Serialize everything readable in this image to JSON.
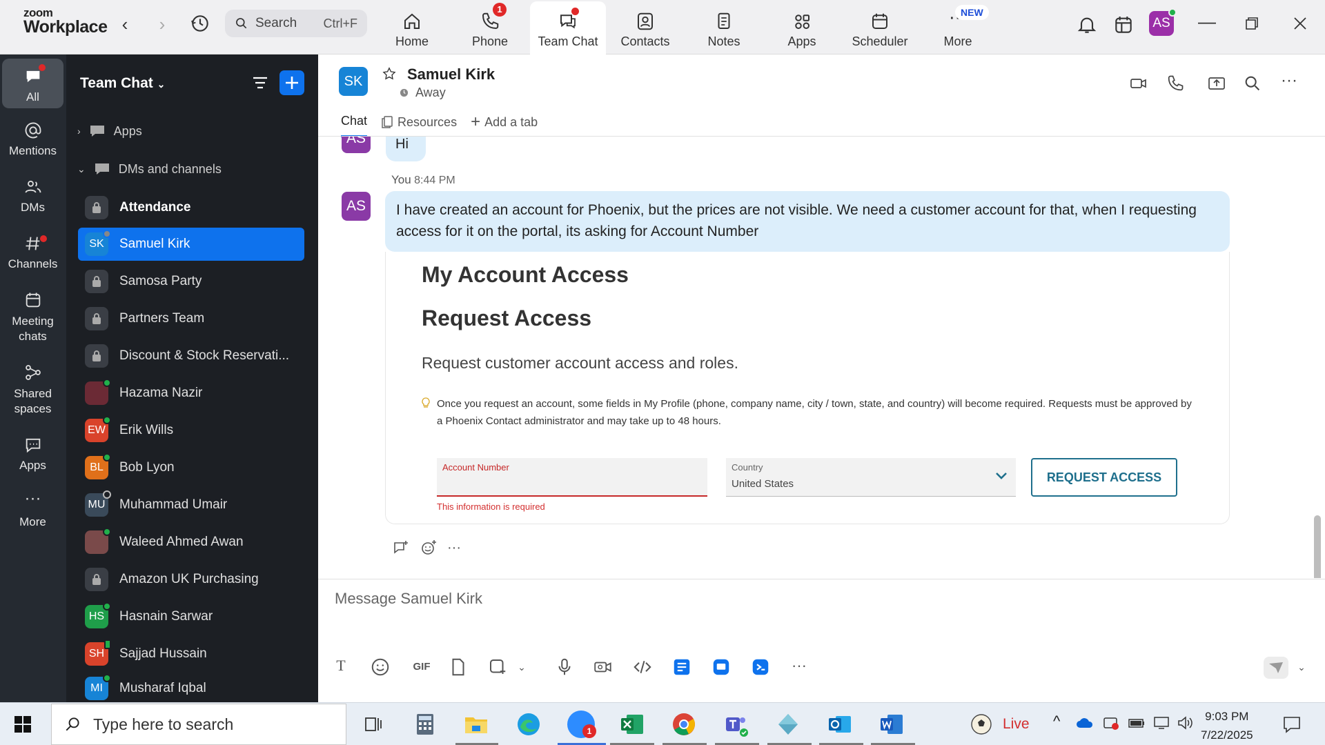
{
  "topbar": {
    "logo_line1": "zoom",
    "logo_line2": "Workplace",
    "search_placeholder": "Search",
    "search_shortcut": "Ctrl+F",
    "tabs": [
      {
        "label": "Home",
        "icon": "home-icon"
      },
      {
        "label": "Phone",
        "icon": "phone-icon",
        "badge": "1"
      },
      {
        "label": "Team Chat",
        "icon": "chat-icon",
        "active": true
      },
      {
        "label": "Contacts",
        "icon": "contacts-icon"
      },
      {
        "label": "Notes",
        "icon": "notes-icon"
      },
      {
        "label": "Apps",
        "icon": "apps-icon"
      },
      {
        "label": "Scheduler",
        "icon": "calendar-icon"
      },
      {
        "label": "More",
        "icon": "more-icon",
        "tag": "NEW"
      }
    ],
    "user_initials": "AS"
  },
  "rail": {
    "items": [
      {
        "label": "All",
        "icon": "chat-bubble-icon",
        "active": true
      },
      {
        "label": "Mentions",
        "icon": "at-icon"
      },
      {
        "label": "DMs",
        "icon": "people-icon"
      },
      {
        "label": "Channels",
        "icon": "hash-icon"
      },
      {
        "label": "Meeting chats",
        "icon": "calendar-icon"
      },
      {
        "label": "Shared spaces",
        "icon": "shared-icon"
      },
      {
        "label": "Apps",
        "icon": "apps-icon"
      },
      {
        "label": "More",
        "icon": "ellipsis-icon"
      }
    ]
  },
  "panel": {
    "title": "Team Chat",
    "section_apps": "Apps",
    "section_dms": "DMs and channels",
    "items": [
      {
        "label": "Attendance",
        "type": "lock",
        "bold": true
      },
      {
        "label": "Samuel Kirk",
        "initials": "SK",
        "color": "#1784d6",
        "selected": true
      },
      {
        "label": "Samosa Party",
        "type": "lock"
      },
      {
        "label": "Partners Team",
        "type": "lock"
      },
      {
        "label": "Discount & Stock Reservati...",
        "type": "lock"
      },
      {
        "label": "Hazama Nazir",
        "initials": "",
        "color": "#6b2a35",
        "status": "online"
      },
      {
        "label": "Erik Wills",
        "initials": "EW",
        "color": "#d9432b",
        "status": "online"
      },
      {
        "label": "Bob Lyon",
        "initials": "BL",
        "color": "#e0701a",
        "status": "online"
      },
      {
        "label": "Muhammad Umair",
        "initials": "MU",
        "color": "#3a4a5a",
        "status": "away"
      },
      {
        "label": "Waleed Ahmed Awan",
        "initials": "",
        "color": "#7a4a4a",
        "status": "online"
      },
      {
        "label": "Amazon UK Purchasing",
        "type": "lock"
      },
      {
        "label": "Hasnain Sarwar",
        "initials": "HS",
        "color": "#1f9e4a",
        "status": "online"
      },
      {
        "label": "Sajjad Hussain",
        "initials": "SH",
        "color": "#d9432b",
        "status": "mobile"
      },
      {
        "label": "Musharaf Iqbal",
        "initials": "MI",
        "color": "#1784d6",
        "status": "online"
      }
    ]
  },
  "chat": {
    "contact_initials": "SK",
    "contact_name": "Samuel Kirk",
    "contact_status": "Away",
    "tabs": [
      "Chat",
      "Resources",
      "Add a tab"
    ],
    "prev_message": "Hi",
    "sender_initials": "AS",
    "msg_sender": "You",
    "msg_time": "8:44 PM",
    "msg_text": "I have created an account for Phoenix, but the prices are not visible. We need a customer account for that, when I requesting access for it on the portal, its asking for Account Number",
    "card": {
      "h1": "My Account Access",
      "h2": "Request Access",
      "subtitle": "Request customer account access and roles.",
      "note": "Once you request an account, some fields in My Profile (phone, company name, city / town, state, and country) will become required. Requests must be approved by a Phoenix Contact administrator and may take up to 48 hours.",
      "field1_label": "Account Number",
      "field1_error": "This information is required",
      "field2_label": "Country",
      "field2_value": "United States",
      "button": "REQUEST ACCESS"
    },
    "composer_placeholder": "Message Samuel Kirk",
    "composer_tools": [
      "T",
      "GIF"
    ]
  },
  "taskbar": {
    "search_placeholder": "Type here to search",
    "live_label": "Live",
    "time": "9:03 PM",
    "date": "7/22/2025",
    "zoom_badge": "1"
  }
}
